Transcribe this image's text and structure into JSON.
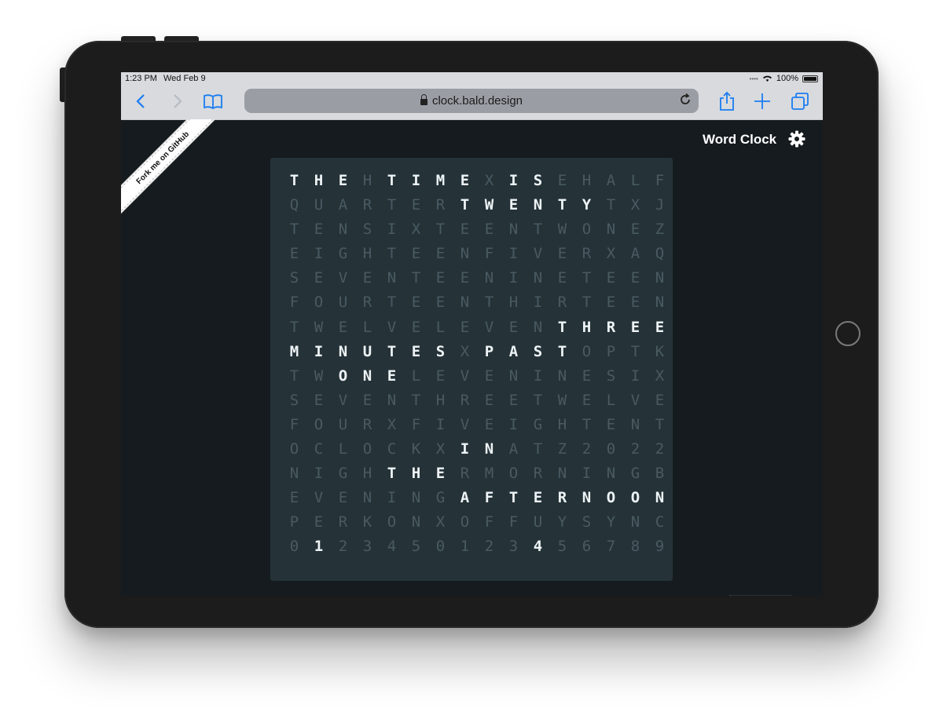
{
  "status": {
    "time": "1:23 PM",
    "date": "Wed Feb 9",
    "battery": "100%"
  },
  "browser": {
    "url": "clock.bald.design"
  },
  "ribbon": {
    "text": "Fork me on GitHub"
  },
  "header": {
    "title": "Word Clock"
  },
  "clock": {
    "rows": [
      "THEHTIMEXISEHALF",
      "QUARTERTWENTYTXJ",
      "TENSIXTEENTWONEZ",
      "EIGHTEENFIVERXAQ",
      "SEVENTEENINETEEN",
      "FOURTEENTHIRTEEN",
      "TWELVELEVENTHREE",
      "MINUTESXPASTOPTK",
      "TWONELEVENINESIX",
      "SEVENTHREETWELVE",
      "FOURXFIVEIGHTENT",
      "OCLOCKXINATZ2022",
      "NIGHTHERMORNINGB",
      "EVENINGAFTERNOON",
      "PERKONXOFFUYSYNC",
      "0123450123456789"
    ],
    "lit": [
      [
        0,
        1,
        2,
        4,
        5,
        6,
        7,
        9,
        10
      ],
      [
        7,
        8,
        9,
        10,
        11,
        12
      ],
      [],
      [],
      [],
      [],
      [
        11,
        12,
        13,
        14,
        15
      ],
      [
        0,
        1,
        2,
        3,
        4,
        5,
        6,
        8,
        9,
        10,
        11
      ],
      [
        2,
        3,
        4
      ],
      [],
      [],
      [
        7,
        8
      ],
      [
        4,
        5,
        6
      ],
      [
        7,
        8,
        9,
        10,
        11,
        12,
        13,
        14,
        15
      ],
      [],
      [
        1,
        10
      ]
    ],
    "on_color": "#eef3f5",
    "off_color": "#4a5a61",
    "background": "#253339"
  }
}
